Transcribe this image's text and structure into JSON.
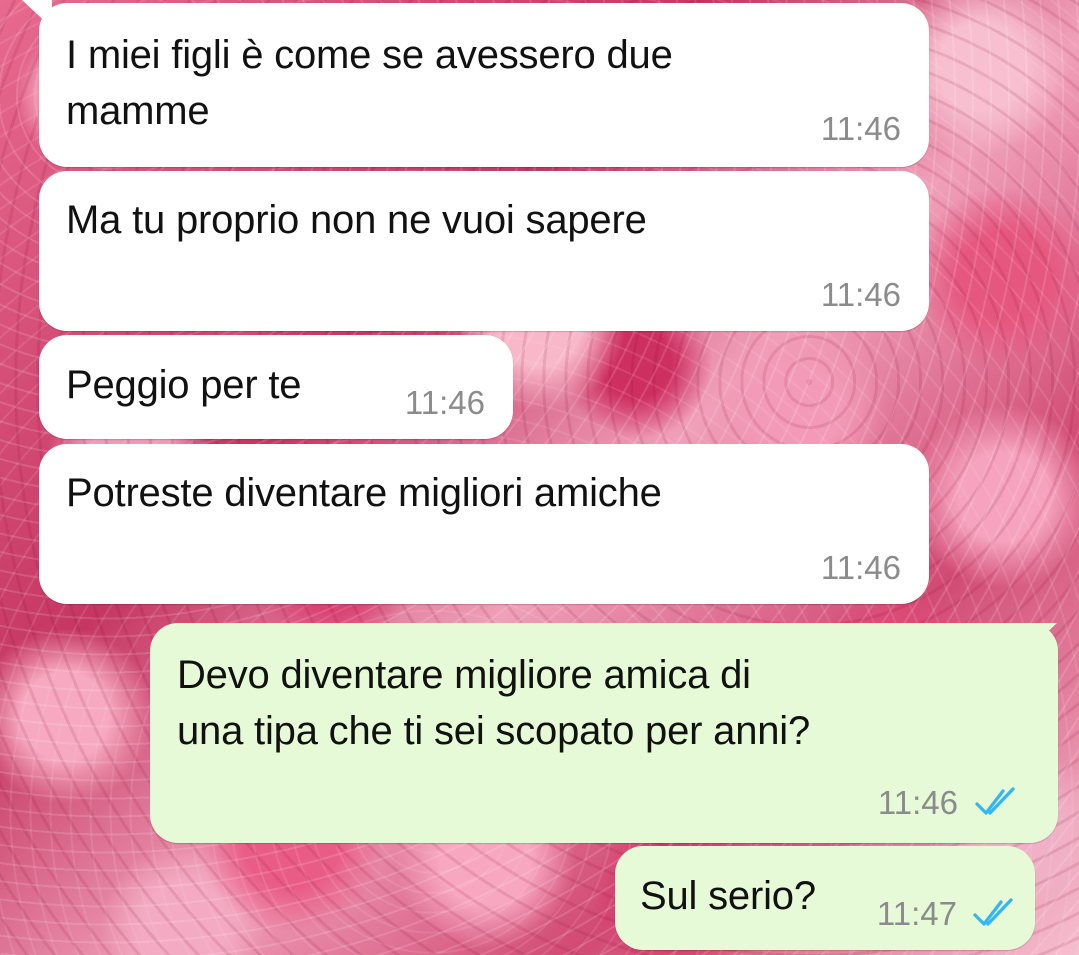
{
  "messages": [
    {
      "text": "I miei figli è come se avessero due\nmamme",
      "time": "11:46"
    },
    {
      "text": "Ma tu proprio non ne vuoi sapere",
      "time": "11:46"
    },
    {
      "text": "Peggio per te",
      "time": "11:46"
    },
    {
      "text": "Potreste diventare migliori amiche",
      "time": "11:46"
    },
    {
      "text": "Devo diventare migliore amica di\nuna tipa che ti sei scopato per anni?",
      "time": "11:46",
      "status": "double-check-icon"
    },
    {
      "text": "Sul serio?",
      "time": "11:47",
      "status": "double-check-icon"
    }
  ],
  "colors": {
    "incoming_bubble": "#ffffff",
    "outgoing_bubble": "#e7fad7",
    "read_receipt": "#34b7f1",
    "timestamp": "#8b8b8b"
  }
}
